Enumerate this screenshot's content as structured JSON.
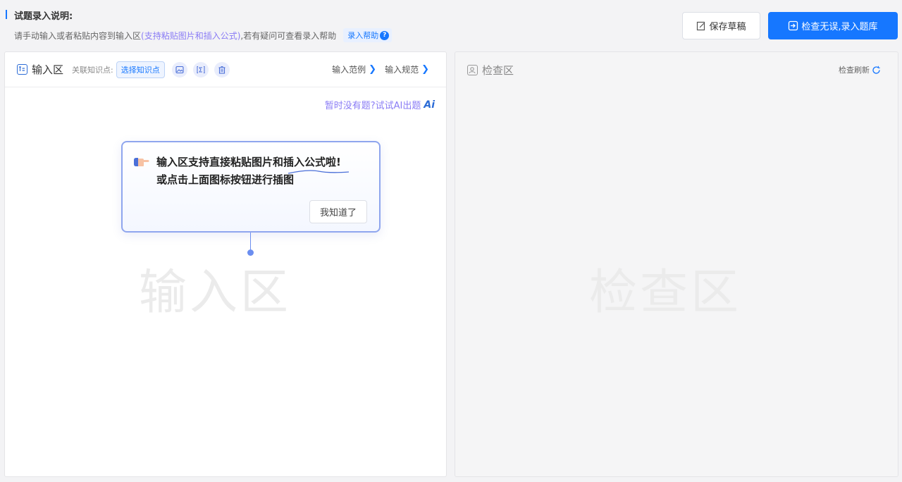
{
  "header": {
    "title": "试题录入说明:",
    "desc_prefix": "请手动输入或者粘贴内容到输入区",
    "desc_highlight": "(支持粘贴图片和插入公式)",
    "desc_suffix": ",若有疑问可查看录入帮助",
    "help_label": "录入帮助",
    "help_icon": "question-icon"
  },
  "toolbar": {
    "save_draft_label": "保存草稿",
    "submit_label": "检查无误,录入题库"
  },
  "input_panel": {
    "title": "输入区",
    "knowledge_label": "关联知识点:",
    "knowledge_button": "选择知识点",
    "tools": [
      "image-icon",
      "formula-icon",
      "trash-icon"
    ],
    "example_link": "输入范例",
    "rules_link": "输入规范",
    "ai_tip": "暂时没有题?试试AI出题",
    "ai_mark": "Ai",
    "watermark": "输入区"
  },
  "tooltip": {
    "line1": "输入区支持直接粘贴图片和插入公式啦!",
    "line2": "或点击上面图标按钮进行插图",
    "ok_label": "我知道了"
  },
  "check_panel": {
    "title": "检查区",
    "refresh_label": "检查刷新",
    "watermark": "检查区"
  },
  "colors": {
    "primary": "#1677ff",
    "highlight": "#8a7cf5"
  }
}
